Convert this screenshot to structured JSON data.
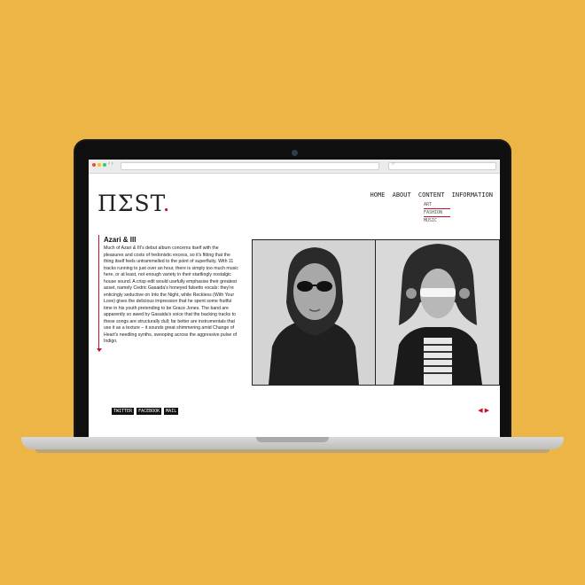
{
  "site": {
    "logo": {
      "text": "ΠΣST",
      "accent": "."
    },
    "menu": [
      "HOME",
      "ABOUT",
      "CONTENT",
      "INFORMATION"
    ],
    "submenu": [
      "ART",
      "FASHION",
      "MUSIC"
    ]
  },
  "article": {
    "title": "Azari & III",
    "body": "Much of Azari & III's debut album concerns itself with the pleasures and costs of hedonistic excess, so it's fitting that the thing itself feels untrammelled to the point of superfluity. With 11 tracks running to just over an hour, there is simply too much music here, or at least, not enough variety in their startlingly nostalgic house sound. A crisp edit would usefully emphasise their greatest asset, namely Cedric Gasaida's honeyed falsetto vocals: they're enticingly seductive on Into the Night, while Reckless (With Your Love) gives the delicious impression that he spent some fruitful time in his youth pretending to be Grace Jones. The band are apparently so awed by Gasaida's voice that the backing tracks to these songs are structurally dull; far better are instrumentals that use it as a texture – it sounds great shimmering amid Change of Heart's needling synths, swooping across the aggressive pulse of Indigo."
  },
  "social": [
    "TWITTER",
    "FACEBOOK",
    "MAIL"
  ],
  "pager": {
    "prev": "◀",
    "next": "▶"
  },
  "colors": {
    "background": "#EDB446",
    "accent": "#c8102e"
  }
}
